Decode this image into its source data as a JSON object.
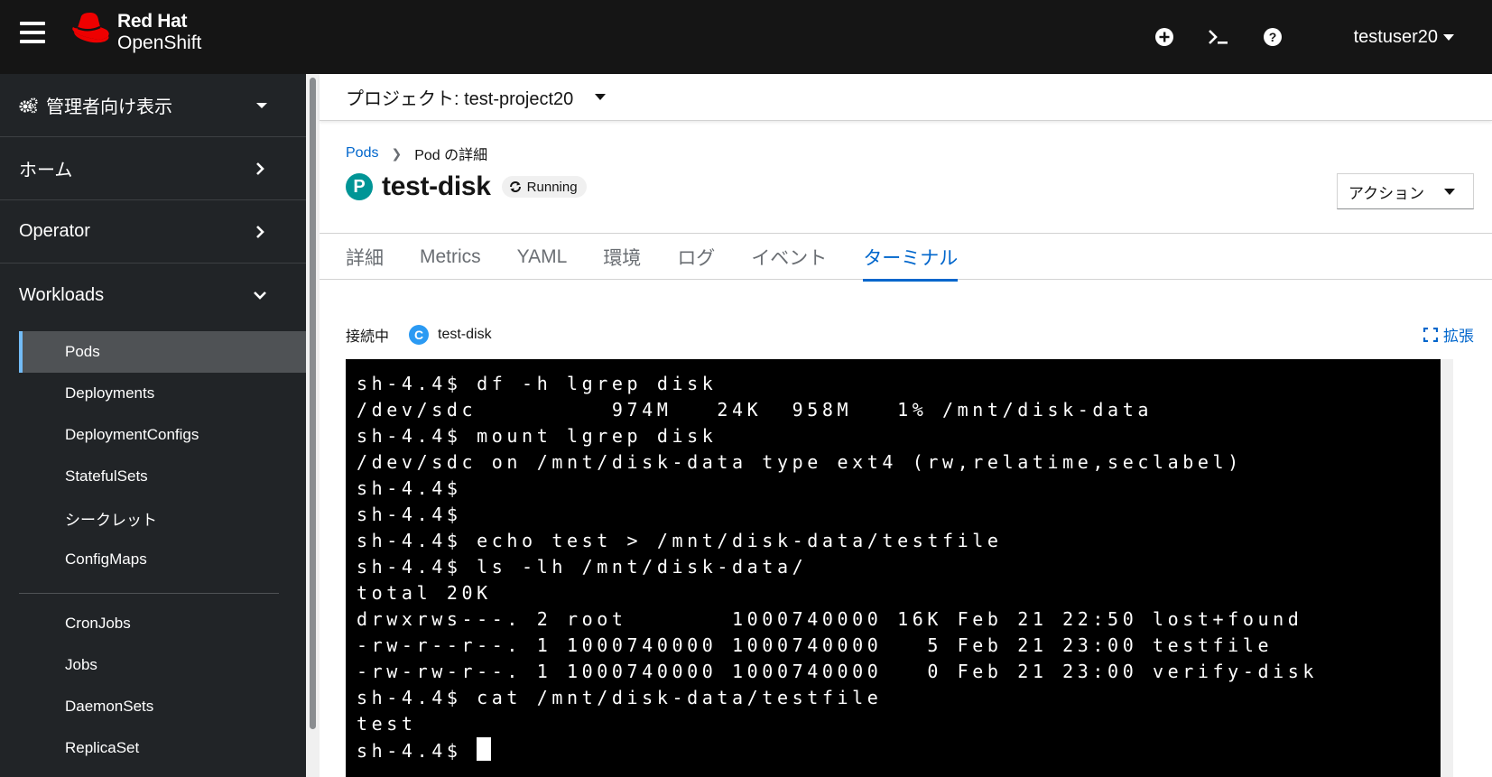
{
  "masthead": {
    "brand": "Red Hat",
    "product": "OpenShift",
    "user": "testuser20",
    "icons": [
      "add-circle-icon",
      "terminal-icon",
      "help-icon"
    ]
  },
  "sidebar": {
    "perspective": "管理者向け表示",
    "sections": [
      {
        "label": "ホーム"
      },
      {
        "label": "Operator"
      },
      {
        "label": "Workloads"
      }
    ],
    "workloads": [
      "Pods",
      "Deployments",
      "DeploymentConfigs",
      "StatefulSets",
      "シークレット",
      "ConfigMaps"
    ],
    "workloads2": [
      "CronJobs",
      "Jobs",
      "DaemonSets",
      "ReplicaSet"
    ]
  },
  "project": {
    "label": "プロジェクト: test-project20"
  },
  "breadcrumb": {
    "parent": "Pods",
    "current": "Pod の詳細"
  },
  "pod": {
    "badge": "P",
    "name": "test-disk",
    "status": "Running"
  },
  "actions_label": "アクション",
  "tabs": [
    "詳細",
    "Metrics",
    "YAML",
    "環境",
    "ログ",
    "イベント",
    "ターミナル"
  ],
  "terminal": {
    "connecting_label": "接続中",
    "container_badge": "C",
    "container": "test-disk",
    "expand_label": "拡張",
    "lines": [
      "sh-4.4$ df -h lgrep disk",
      "/dev/sdc         974M   24K  958M   1% /mnt/disk-data",
      "sh-4.4$ mount lgrep disk",
      "/dev/sdc on /mnt/disk-data type ext4 (rw,relatime,seclabel)",
      "sh-4.4$",
      "sh-4.4$",
      "sh-4.4$ echo test > /mnt/disk-data/testfile",
      "sh-4.4$ ls -lh /mnt/disk-data/",
      "total 20K",
      "drwxrws---. 2 root       1000740000 16K Feb 21 22:50 lost+found",
      "-rw-r--r--. 1 1000740000 1000740000   5 Feb 21 23:00 testfile",
      "-rw-rw-r--. 1 1000740000 1000740000   0 Feb 21 23:00 verify-disk",
      "sh-4.4$ cat /mnt/disk-data/testfile",
      "test"
    ],
    "prompt": "sh-4.4$ "
  }
}
